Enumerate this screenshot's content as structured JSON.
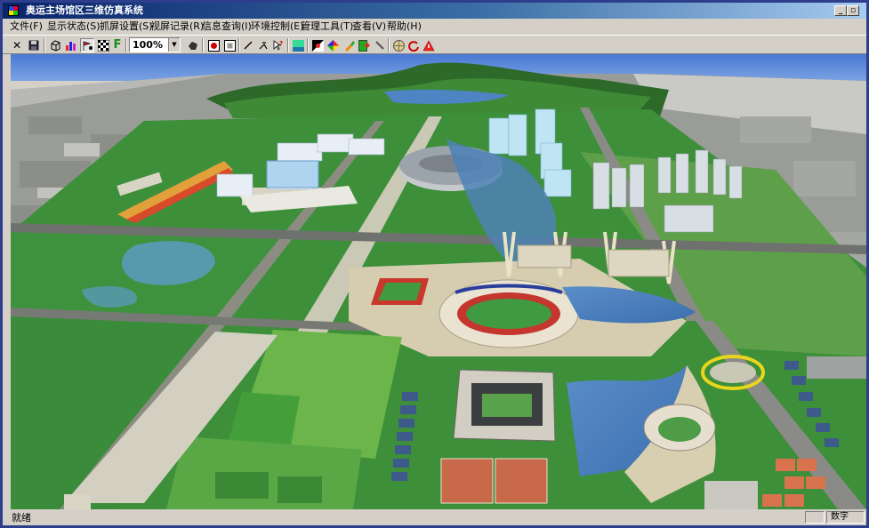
{
  "window": {
    "title": "奥运主场馆区三维仿真系统"
  },
  "menu": [
    "文件(F)",
    "显示状态(S)",
    "抓屏设置(S)",
    "视屏记录(R)",
    "信息查询(I)",
    "环境控制(E)",
    "管理工具(T)",
    "查看(V)",
    "帮助(H)"
  ],
  "toolbar": {
    "zoom_value": "100%"
  },
  "status": {
    "ready": "就绪",
    "numlock": "数字"
  }
}
